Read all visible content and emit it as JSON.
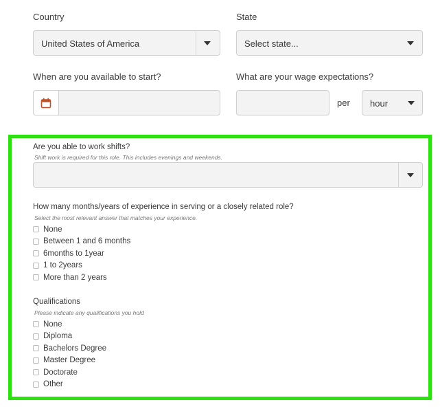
{
  "country": {
    "label": "Country",
    "value": "United States of America"
  },
  "state": {
    "label": "State",
    "placeholder": "Select state..."
  },
  "start": {
    "label": "When are you available to start?",
    "value": ""
  },
  "wage": {
    "label": "What are your wage expectations?",
    "value": "",
    "per_text": "per",
    "period": "hour"
  },
  "shifts": {
    "question": "Are you able to work shifts?",
    "hint": "Shift work is required for this role. This includes evenings and weekends.",
    "value": ""
  },
  "experience": {
    "question": "How many months/years of experience in serving or a closely related role?",
    "hint": "Select the most relevant answer that matches your experience.",
    "options": [
      "None",
      "Between 1 and 6 months",
      "6months to 1year",
      "1 to 2years",
      "More than 2 years"
    ]
  },
  "qualifications": {
    "question": "Qualifications",
    "hint": "Please indicate any qualifications you hold",
    "options": [
      "None",
      "Diploma",
      "Bachelors Degree",
      "Master Degree",
      "Doctorate",
      "Other"
    ]
  },
  "colors": {
    "highlight": "#2de010",
    "calendar_icon": "#c0522a",
    "field_bg": "#f3f3f3"
  }
}
